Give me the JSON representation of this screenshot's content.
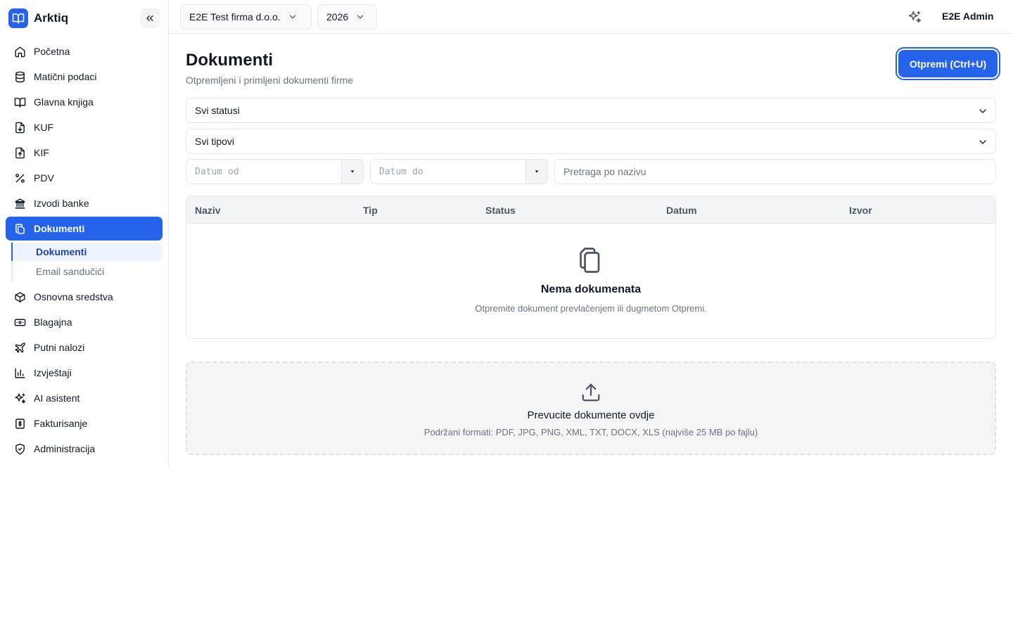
{
  "app": {
    "name": "Arktiq",
    "logo_icon": "book-open-icon",
    "brand_color": "#2563eb"
  },
  "sidebar": {
    "items": [
      {
        "label": "Početna",
        "icon": "home-icon"
      },
      {
        "label": "Matični podaci",
        "icon": "database-icon"
      },
      {
        "label": "Glavna knjiga",
        "icon": "book-icon"
      },
      {
        "label": "KUF",
        "icon": "file-download-icon"
      },
      {
        "label": "KIF",
        "icon": "file-upload-icon"
      },
      {
        "label": "PDV",
        "icon": "percent-icon"
      },
      {
        "label": "Izvodi banke",
        "icon": "bank-icon"
      },
      {
        "label": "Dokumenti",
        "icon": "files-icon",
        "active": true
      },
      {
        "label": "Osnovna sredstva",
        "icon": "box-icon"
      },
      {
        "label": "Blagajna",
        "icon": "cash-icon"
      },
      {
        "label": "Putni nalozi",
        "icon": "plane-icon"
      },
      {
        "label": "Izvještaji",
        "icon": "bar-chart-icon"
      },
      {
        "label": "AI asistent",
        "icon": "sparkles-icon"
      },
      {
        "label": "Fakturisanje",
        "icon": "invoice-icon"
      },
      {
        "label": "Administracija",
        "icon": "shield-check-icon"
      }
    ],
    "sub_items": [
      {
        "label": "Dokumenti",
        "active": true
      },
      {
        "label": "Email sandučići",
        "active": false
      }
    ]
  },
  "topbar": {
    "company": "E2E Test firma d.o.o.",
    "year": "2026",
    "user": "E2E Admin"
  },
  "main": {
    "title": "Dokumenti",
    "subtitle": "Otpremljeni i primljeni dokumenti firme",
    "upload_button": "Otpremi (Ctrl+U)",
    "filters": {
      "status": "Svi statusi",
      "type": "Svi tipovi",
      "date_from_placeholder": "Datum od",
      "date_to_placeholder": "Datum do",
      "search_placeholder": "Pretraga po nazivu"
    },
    "table": {
      "columns": [
        "Naziv",
        "Tip",
        "Status",
        "Datum",
        "Izvor"
      ],
      "empty_title": "Nema dokumenata",
      "empty_text": "Otpremite dokument prevlačenjem ili dugmetom Otpremi."
    },
    "dropzone": {
      "title": "Prevucite dokumente ovdje",
      "text": "Podržani formati: PDF, JPG, PNG, XML, TXT, DOCX, XLS (najviše 25 MB po fajlu)"
    }
  }
}
